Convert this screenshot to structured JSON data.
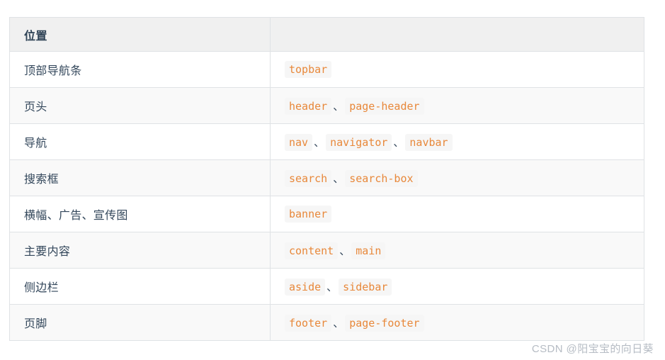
{
  "table": {
    "headers": [
      "位置",
      ""
    ],
    "rows": [
      {
        "location": "顶部导航条",
        "tokens": [
          "topbar"
        ]
      },
      {
        "location": "页头",
        "tokens": [
          "header",
          "page-header"
        ]
      },
      {
        "location": "导航",
        "tokens": [
          "nav",
          "navigator",
          "navbar"
        ]
      },
      {
        "location": "搜索框",
        "tokens": [
          "search",
          "search-box"
        ]
      },
      {
        "location": "横幅、广告、宣传图",
        "tokens": [
          "banner"
        ]
      },
      {
        "location": "主要内容",
        "tokens": [
          "content",
          "main"
        ]
      },
      {
        "location": "侧边栏",
        "tokens": [
          "aside",
          "sidebar"
        ]
      },
      {
        "location": "页脚",
        "tokens": [
          "footer",
          "page-footer"
        ]
      }
    ],
    "token_separator": "、"
  },
  "watermark": {
    "text": "CSDN @阳宝宝的向日葵"
  },
  "colors": {
    "token_text": "#e8883a",
    "token_background": "#f6f6f6",
    "header_background": "#f0f0f0",
    "border": "#dfe2e5",
    "body_text": "#33475b",
    "stripe": "#f9f9f9",
    "watermark": "#b6bcc4"
  }
}
